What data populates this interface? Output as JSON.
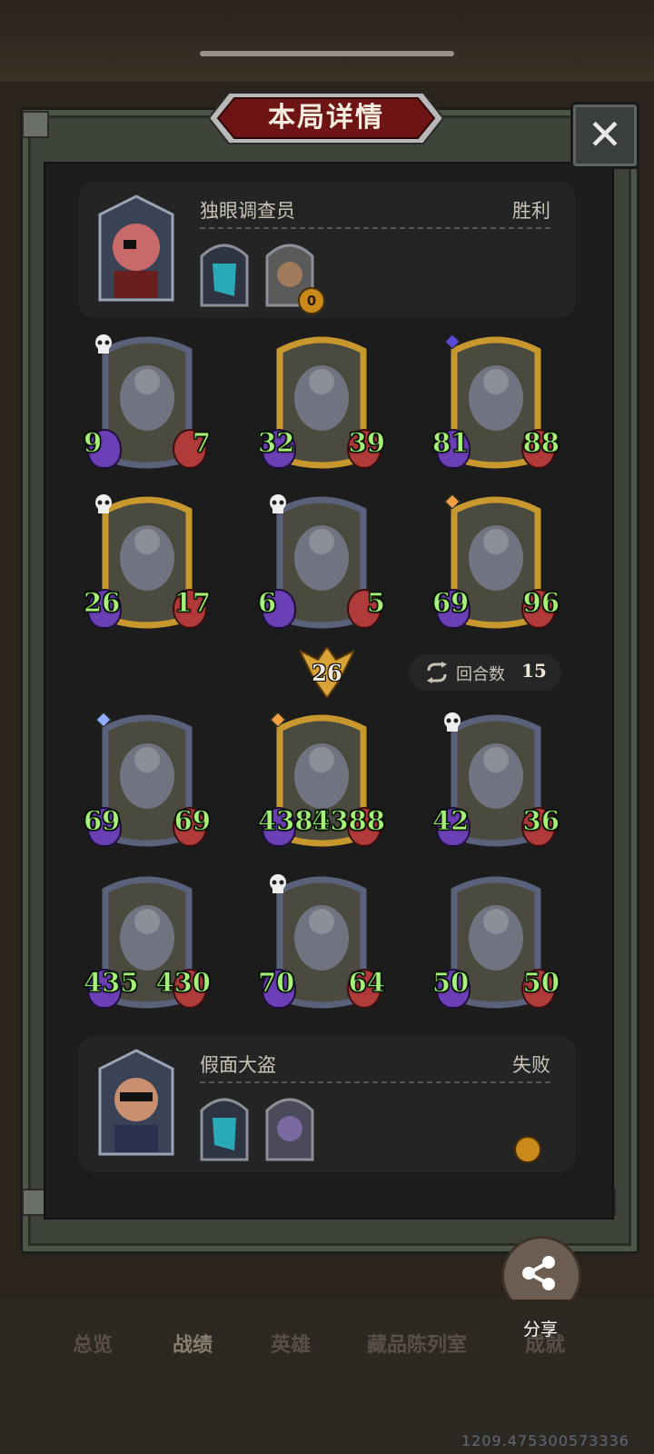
{
  "title": "本局详情",
  "close_label": "✕",
  "player_top": {
    "name": "独眼调查员",
    "result": "胜利",
    "coin_value": "0"
  },
  "player_bottom": {
    "name": "假面大盗",
    "result": "失败"
  },
  "top_board": [
    {
      "atk": "9",
      "hp": "7",
      "frame": "silver",
      "gem": "#8fb0ff",
      "skull": true
    },
    {
      "atk": "32",
      "hp": "39",
      "frame": "gold",
      "gem": "",
      "skull": false
    },
    {
      "atk": "81",
      "hp": "88",
      "frame": "gold",
      "gem": "#5a4bd8",
      "skull": false
    },
    {
      "atk": "26",
      "hp": "17",
      "frame": "gold",
      "gem": "",
      "skull": true
    },
    {
      "atk": "6",
      "hp": "5",
      "frame": "silver",
      "gem": "",
      "skull": true
    },
    {
      "atk": "69",
      "hp": "96",
      "frame": "gold",
      "gem": "#f0a040",
      "skull": false
    }
  ],
  "bottom_board": [
    {
      "atk": "69",
      "hp": "69",
      "frame": "silver",
      "gem": "#8fb0ff",
      "skull": false
    },
    {
      "atk": "4385",
      "hp": "4388",
      "frame": "gold",
      "gem": "#f0a040",
      "skull": false
    },
    {
      "atk": "42",
      "hp": "36",
      "frame": "silver",
      "gem": "#8fb0ff",
      "skull": true
    },
    {
      "atk": "435",
      "hp": "430",
      "frame": "silver",
      "gem": "",
      "skull": false
    },
    {
      "atk": "70",
      "hp": "64",
      "frame": "silver",
      "gem": "",
      "skull": true
    },
    {
      "atk": "50",
      "hp": "50",
      "frame": "silver",
      "gem": "",
      "skull": false
    }
  ],
  "tier_badge": "26",
  "round": {
    "label": "回合数",
    "value": "15"
  },
  "tabs": [
    "总览",
    "战绩",
    "英雄",
    "藏品陈列室",
    "成就"
  ],
  "active_tab": "战绩",
  "share_label": "分享",
  "version": "1209.475300573336",
  "colors": {
    "gold_frame": "#c8982e",
    "silver_frame": "#59627a",
    "stat_text": "#a8f07a"
  }
}
